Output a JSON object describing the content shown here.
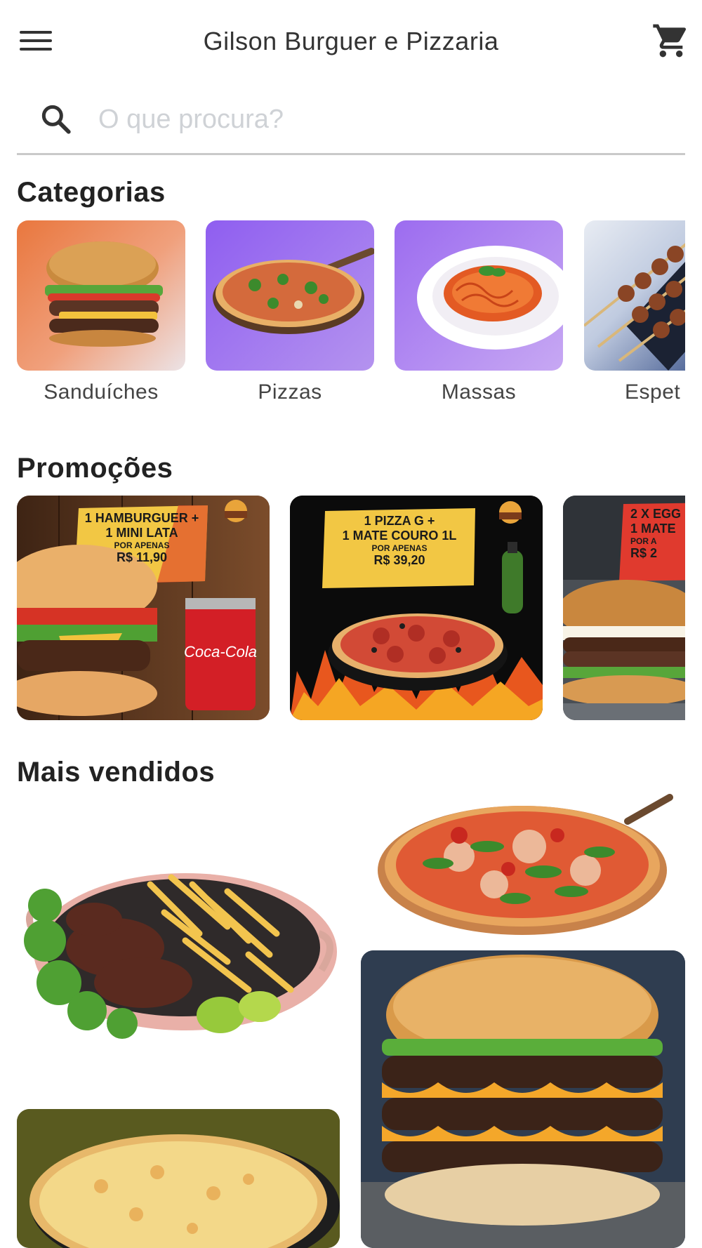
{
  "header": {
    "title": "Gilson Burguer e Pizzaria",
    "menu_icon": "hamburger-menu-icon",
    "cart_icon": "cart-icon"
  },
  "search": {
    "placeholder": "O que procura?",
    "value": ""
  },
  "sections": {
    "categories": "Categorias",
    "promotions": "Promoções",
    "best_sellers": "Mais vendidos"
  },
  "categories": [
    {
      "label": "Sanduíches"
    },
    {
      "label": "Pizzas"
    },
    {
      "label": "Massas"
    },
    {
      "label": "Espet"
    }
  ],
  "promotions": [
    {
      "line1": "1 HAMBURGUER +",
      "line2": "1 MINI LATA",
      "line3": "POR APENAS",
      "price": "R$ 11,90"
    },
    {
      "line1": "1 PIZZA G +",
      "line2": "1 MATE COURO 1L",
      "line3": "POR APENAS",
      "price": "R$ 39,20"
    },
    {
      "line1": "2 X EGG",
      "line2": "1 MATE",
      "line3": "POR A",
      "price": "R$ 2"
    }
  ],
  "colors": {
    "accent": "#f2c744",
    "text": "#2a2a2a",
    "divider": "#c9c9c9",
    "placeholder": "#cfd2d6"
  }
}
